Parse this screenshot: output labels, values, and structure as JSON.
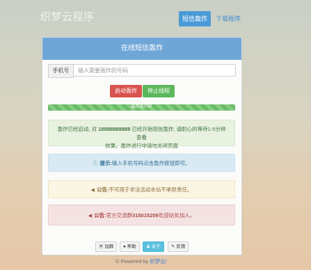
{
  "header": {
    "brand": "织梦云程序",
    "nav_active": "短信轰炸",
    "nav_link": "下载程序"
  },
  "panel": {
    "title": "在线短信轰炸"
  },
  "form": {
    "phone_label": "手机号",
    "phone_placeholder": "输入需要轰炸的号码"
  },
  "buttons": {
    "start": "启动轰炸",
    "stop": "停止线程"
  },
  "progress": {
    "label": "轰炸进行中",
    "percent": 100
  },
  "status": {
    "line1_prefix": "轰炸已经启动, 对",
    "number": "18888888888",
    "line1_suffix": "已经开始短信轰炸, 请耐心的等待1-5分钟查看",
    "line2": "效果。轰炸进行中请勿关闭页面"
  },
  "tip": {
    "icon": "info-icon",
    "prefix": "提示:",
    "text": "输入手机号码点击轰炸按钮即可。"
  },
  "notice": {
    "icon": "bullhorn-icon",
    "prefix": "公告:",
    "text": "不可用于非法活动本站不承担责任。"
  },
  "group": {
    "icon": "bullhorn-icon",
    "prefix": "公告:",
    "text_before": "官方交流群",
    "number": "315015209",
    "text_after": "欢迎站长加入。"
  },
  "links": {
    "join": "加群",
    "help": "帮助",
    "about": "关于",
    "feedback": "反馈"
  },
  "footer": {
    "prefix": "© Powered by",
    "link": "织梦云!"
  },
  "colors": {
    "panel_header": "#6fa6d8",
    "start_button": "#d9534f",
    "stop_button": "#5cb85c",
    "nav_active": "#4a9bd8"
  }
}
